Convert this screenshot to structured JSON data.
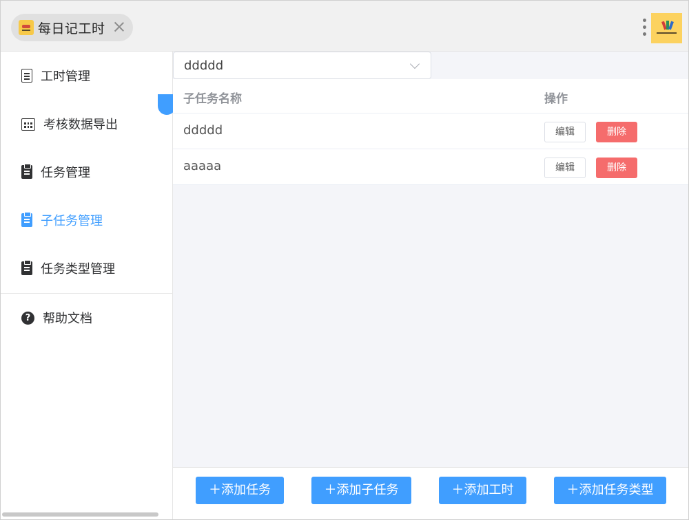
{
  "titlebar": {
    "tab_title": "每日记工时",
    "app_icon": "app-logo-icon",
    "close_icon": "close-icon",
    "menu_icon": "more-vertical-icon",
    "avatar": "user-avatar"
  },
  "sidebar": {
    "items": [
      {
        "label": "工时管理",
        "icon": "document-icon",
        "active": false
      },
      {
        "label": "考核数据导出",
        "icon": "calendar-icon",
        "active": false
      },
      {
        "label": "任务管理",
        "icon": "clipboard-icon",
        "active": false
      },
      {
        "label": "子任务管理",
        "icon": "clipboard-icon",
        "active": true
      },
      {
        "label": "任务类型管理",
        "icon": "clipboard-icon",
        "active": false
      }
    ],
    "help": {
      "label": "帮助文档",
      "icon": "help-icon"
    }
  },
  "main": {
    "task_select": {
      "value": "ddddd"
    },
    "table": {
      "columns": [
        "子任务名称",
        "操作"
      ],
      "rows": [
        {
          "name": "ddddd",
          "edit_label": "编辑",
          "delete_label": "删除"
        },
        {
          "name": "aaaaa",
          "edit_label": "编辑",
          "delete_label": "删除"
        }
      ]
    },
    "footer": {
      "buttons": [
        "＋添加任务",
        "＋添加子任务",
        "＋添加工时",
        "＋添加任务类型"
      ]
    }
  },
  "colors": {
    "primary": "#409eff",
    "danger": "#f56c6c",
    "background": "#f4f5f9"
  }
}
